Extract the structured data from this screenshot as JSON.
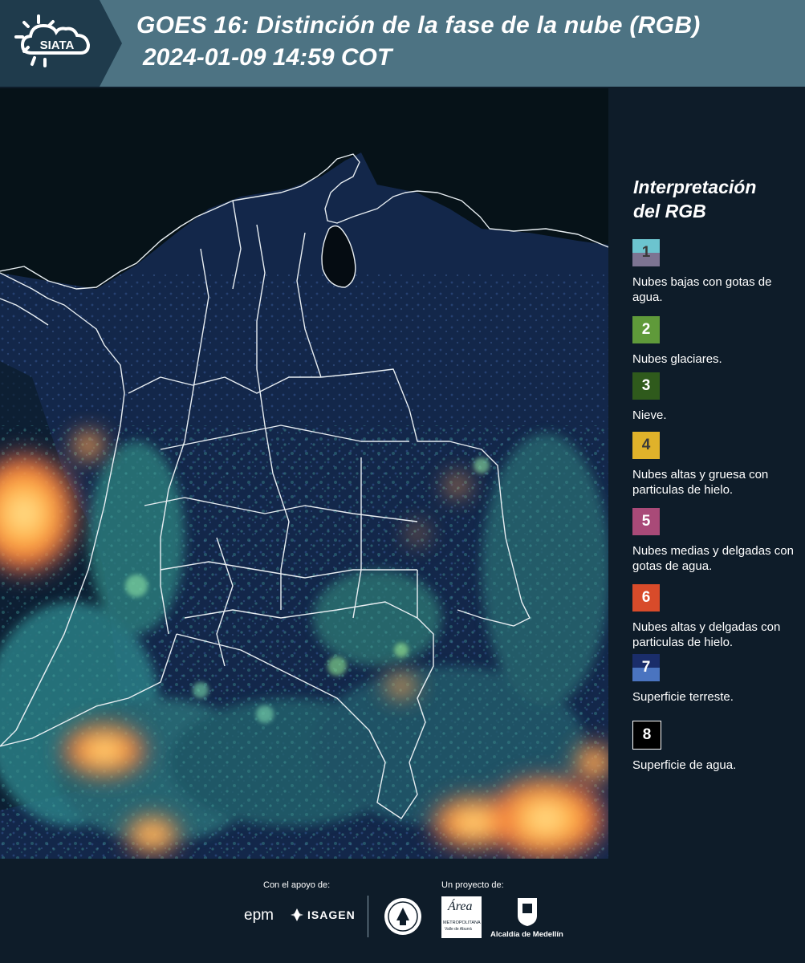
{
  "header": {
    "logo_text": "SIATA",
    "title_line1": "GOES 16: Distinción de la fase de la nube (RGB)",
    "title_line2": "2024-01-09 14:59 COT"
  },
  "legend": {
    "title_line1": "Interpretación",
    "title_line2": "del RGB",
    "items": [
      {
        "number": "1",
        "text": "Nubes bajas con gotas de agua.",
        "color_top": "#6cc4cf",
        "color_bottom": "#7d7492"
      },
      {
        "number": "2",
        "text": "Nubes glaciares.",
        "color_top": "#5f9a3a",
        "color_bottom": "#5f9a3a"
      },
      {
        "number": "3",
        "text": "Nieve.",
        "color_top": "#2f5a1c",
        "color_bottom": "#2f5a1c"
      },
      {
        "number": "4",
        "text": "Nubes altas y gruesa con particulas de hielo.",
        "color_top": "#e0b22a",
        "color_bottom": "#e0b22a"
      },
      {
        "number": "5",
        "text": "Nubes medias y delgadas con gotas de agua.",
        "color_top": "#a94a78",
        "color_bottom": "#a94a78"
      },
      {
        "number": "6",
        "text": "Nubes altas y delgadas con particulas de hielo.",
        "color_top": "#d84b2a",
        "color_bottom": "#d84b2a"
      },
      {
        "number": "7",
        "text": "Superficie terreste.",
        "color_top": "#1a2d6a",
        "color_bottom": "#4a74c0"
      },
      {
        "number": "8",
        "text": "Superficie de agua.",
        "color_top": "#000000",
        "color_bottom": "#000000"
      }
    ]
  },
  "footer": {
    "support_label": "Con el apoyo de:",
    "project_label": "Un proyecto de:",
    "supporters": [
      "epm",
      "ISAGEN"
    ],
    "project_partners": [
      "METROPOLITANA",
      "Valle de Aburrá",
      "Alcaldía de Medellín"
    ],
    "area_logo_text": "Área"
  }
}
